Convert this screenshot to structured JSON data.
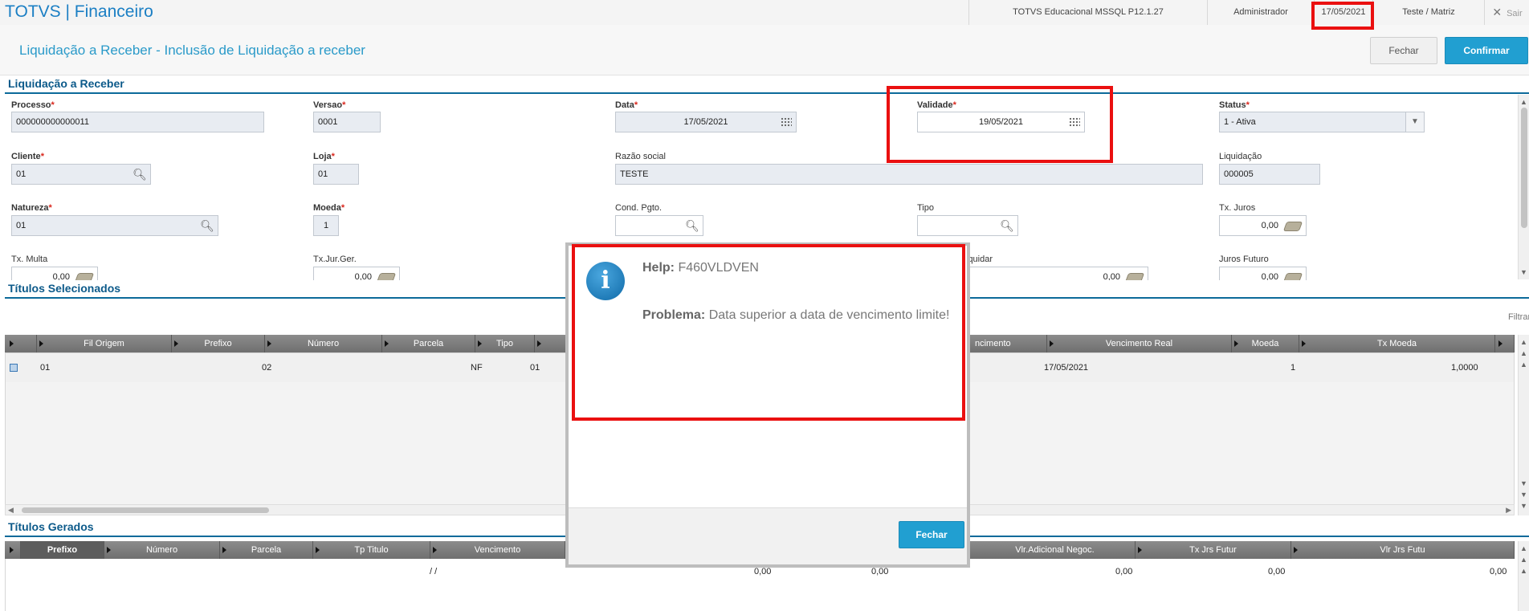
{
  "top_bar": {
    "app_title": "TOTVS | Financeiro",
    "environment": "TOTVS Educacional MSSQL P12.1.27",
    "user": "Administrador",
    "date": "17/05/2021",
    "branch": "Teste / Matriz",
    "exit_label": "Sair"
  },
  "header": {
    "title": "Liquidação a Receber - Inclusão de Liquidação a receber",
    "close_label": "Fechar",
    "confirm_label": "Confirmar"
  },
  "form": {
    "section_title": "Liquidação a Receber",
    "processo": {
      "label": "Processo",
      "value": "000000000000011"
    },
    "versao": {
      "label": "Versao",
      "value": "0001"
    },
    "data": {
      "label": "Data",
      "value": "17/05/2021"
    },
    "validade": {
      "label": "Validade",
      "value": "19/05/2021"
    },
    "status": {
      "label": "Status",
      "value": "1 - Ativa"
    },
    "cliente": {
      "label": "Cliente",
      "value": "01"
    },
    "loja": {
      "label": "Loja",
      "value": "01"
    },
    "razao": {
      "label": "Razão social",
      "value": "TESTE"
    },
    "liquidacao": {
      "label": "Liquidação",
      "value": "000005"
    },
    "natureza": {
      "label": "Natureza",
      "value": "01"
    },
    "moeda": {
      "label": "Moeda",
      "value": "1"
    },
    "cond_pgto": {
      "label": "Cond. Pgto.",
      "value": ""
    },
    "tipo": {
      "label": "Tipo",
      "value": ""
    },
    "tx_juros": {
      "label": "Tx. Juros",
      "value": "0,00"
    },
    "tx_multa": {
      "label": "Tx. Multa",
      "value": "0,00"
    },
    "tx_jur_ger": {
      "label": "Tx.Jur.Ger.",
      "value": "0,00"
    },
    "a_liquidar": {
      "label": "iquidar",
      "value": "0,00"
    },
    "juros_futuro": {
      "label": "Juros Futuro",
      "value": "0,00"
    }
  },
  "titulos_selecionados": {
    "title": "Títulos Selecionados",
    "filter_label": "Filtrar",
    "columns": [
      "Fil Origem",
      "Prefixo",
      "Número",
      "Parcela",
      "Tipo",
      "ncimento",
      "Vencimento Real",
      "Moeda",
      "Tx Moeda"
    ],
    "row": {
      "fil_origem": "01",
      "numero": "02",
      "tipo": "NF",
      "col6": "01",
      "vencimento_real": "17/05/2021",
      "moeda": "1",
      "tx_moeda": "1,0000"
    }
  },
  "titulos_gerados": {
    "title": "Títulos Gerados",
    "columns": [
      "Prefixo",
      "Número",
      "Parcela",
      "Tp Titulo",
      "Vencimento",
      "Vlr.Adicional Negoc.",
      "Tx Jrs Futur",
      "Vlr Jrs Futu"
    ],
    "row": {
      "vencimento": "/ /",
      "v1": "0,00",
      "v2": "0,00",
      "v3": "0,00",
      "v4": "0,00",
      "v5": "0,00"
    }
  },
  "modal": {
    "help_key": "Help:",
    "help_value": "F460VLDVEN",
    "problem_key": "Problema:",
    "problem_value": "Data superior a data de vencimento limite!",
    "close_label": "Fechar",
    "info_glyph": "i"
  },
  "colors": {
    "accent": "#219fd1",
    "title_blue": "#1b7fc4",
    "highlight": "#ea1010"
  }
}
